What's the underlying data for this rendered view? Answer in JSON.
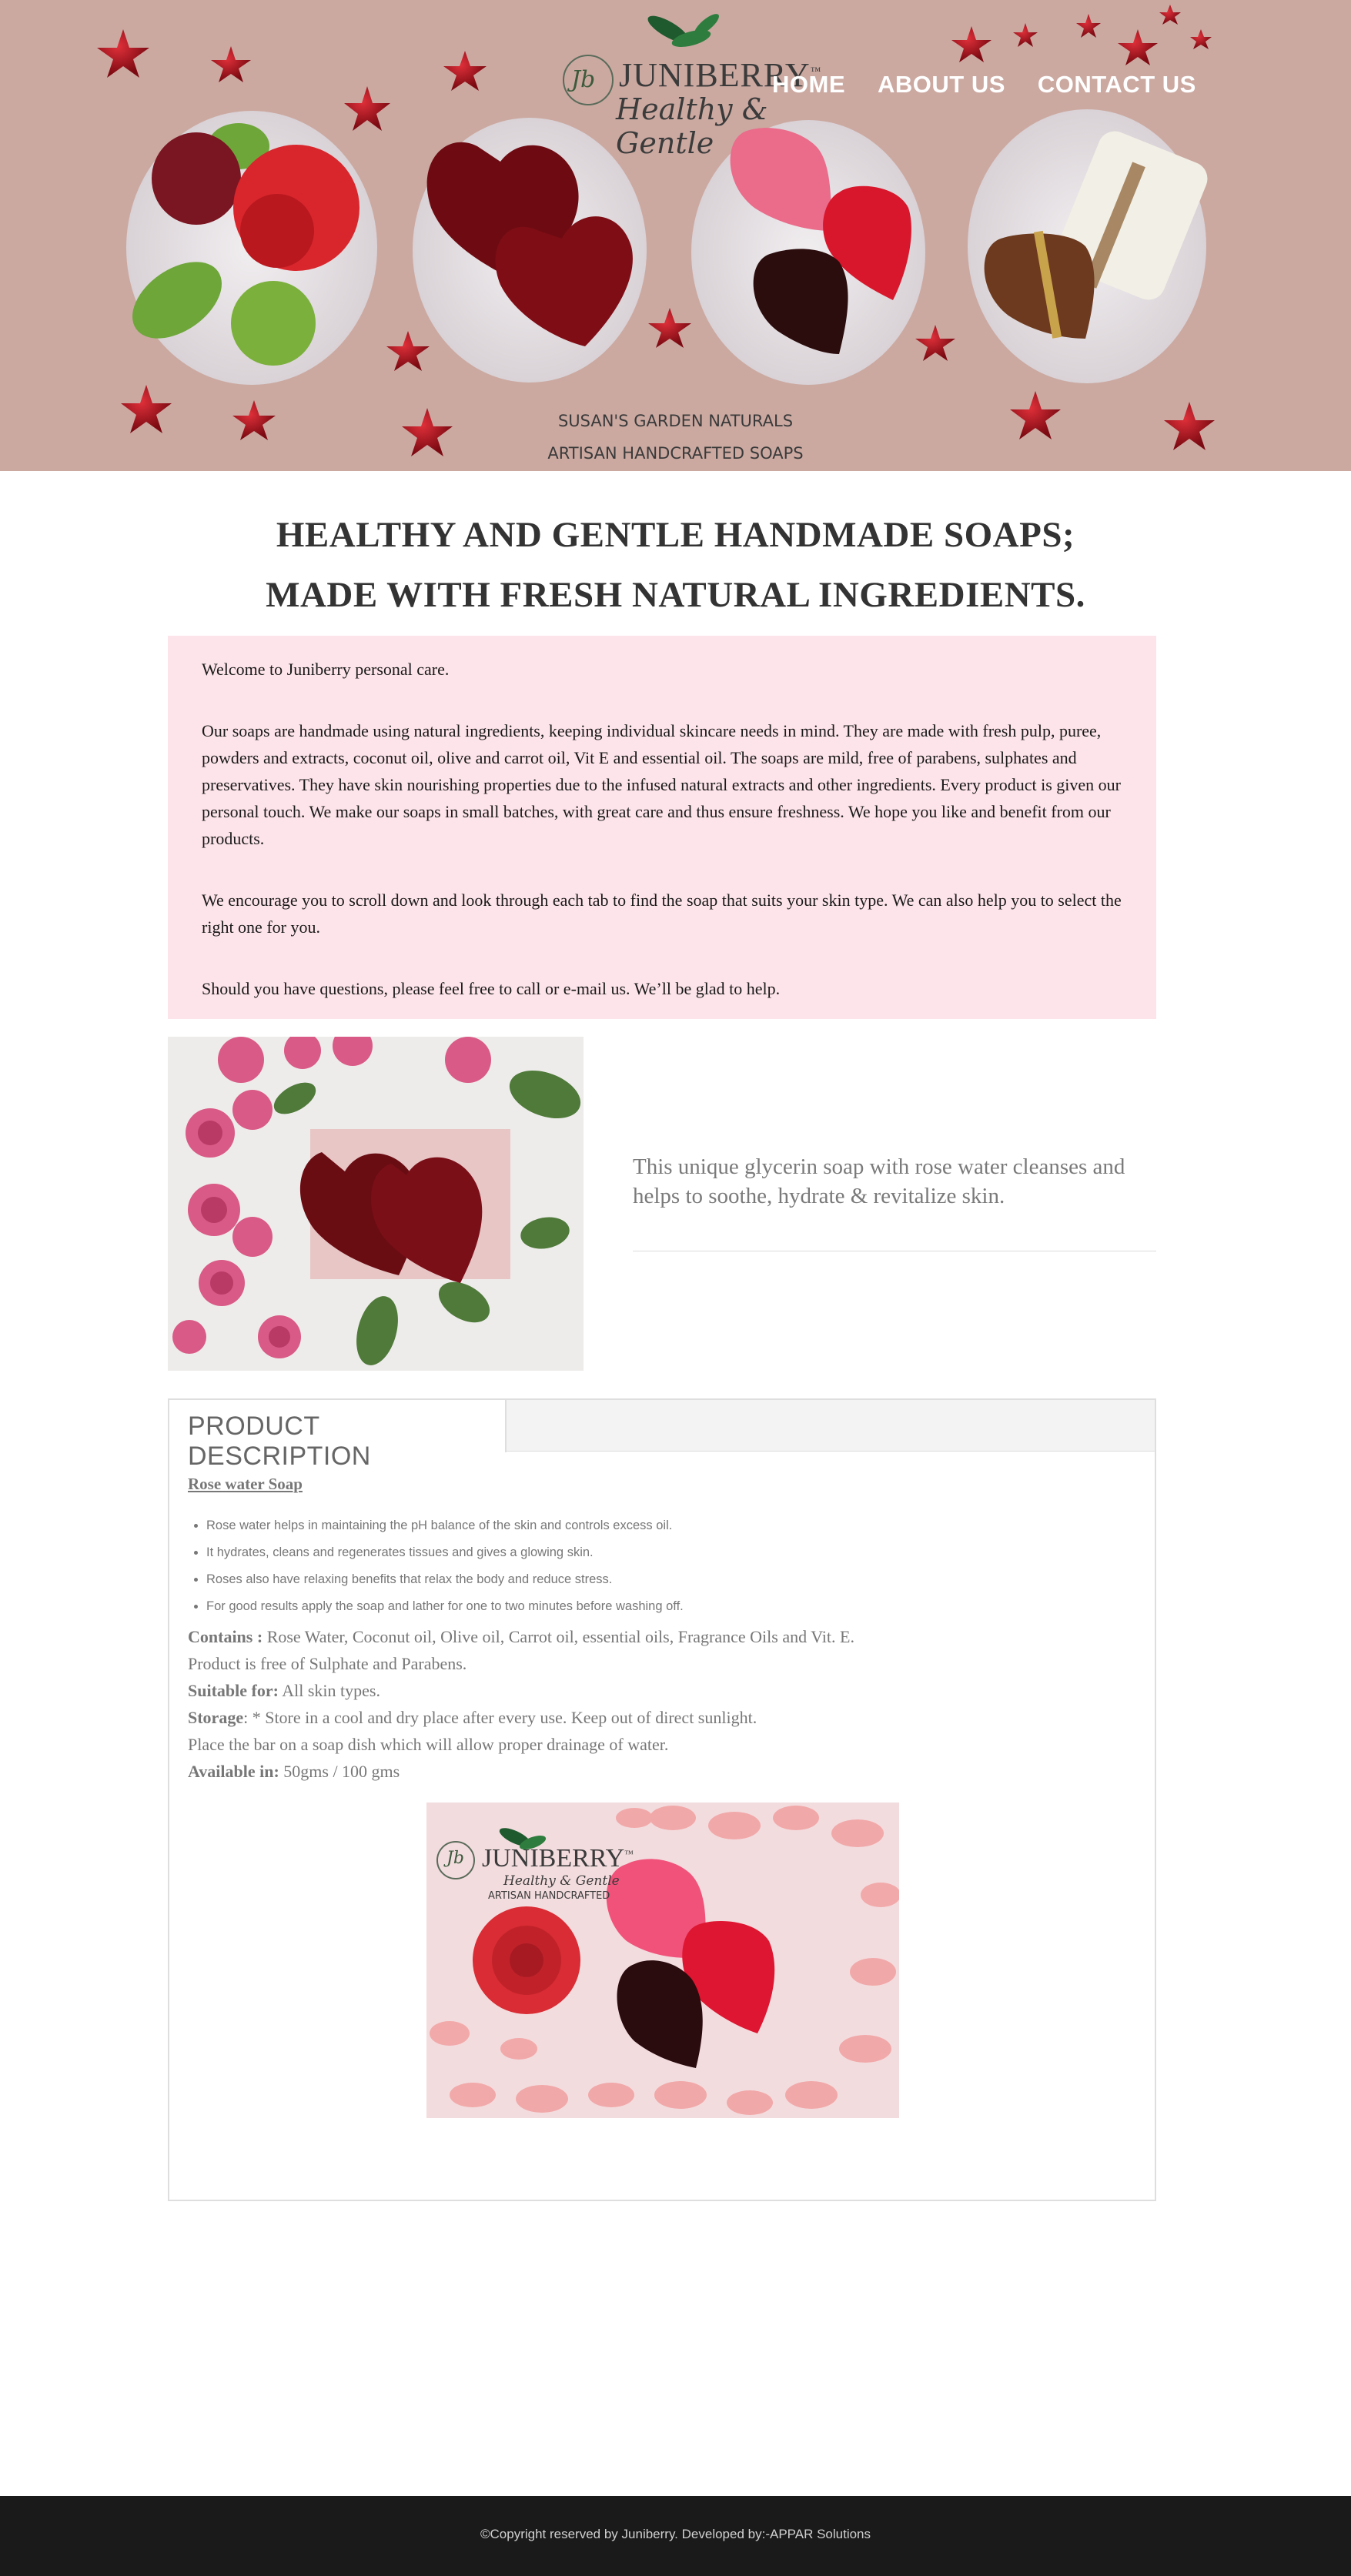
{
  "nav": {
    "items": [
      "HOME",
      "ABOUT US",
      "CONTACT US"
    ]
  },
  "hero": {
    "logo_brand": "JUNIBERRY",
    "logo_tm": "™",
    "logo_monogram": "Jb",
    "logo_tagline": "Healthy & Gentle",
    "caption_line1": "SUSAN'S GARDEN NATURALS",
    "caption_line2": "ARTISAN HANDCRAFTED SOAPS"
  },
  "heading": {
    "line1": "HEALTHY AND GENTLE HANDMADE SOAPS;",
    "line2": "MADE WITH FRESH NATURAL INGREDIENTS."
  },
  "intro": {
    "paragraphs": [
      "Welcome to Juniberry personal care.",
      "Our soaps are handmade using natural ingredients, keeping individual skincare needs in mind. They are made with fresh pulp, puree, powders and extracts, coconut oil, olive and carrot oil, Vit E and essential oil. The soaps are mild, free of parabens, sulphates and preservatives. They have skin nourishing properties due to the infused natural extracts and other ingredients. Every product is given our personal touch. We make our soaps in small batches, with great care and thus ensure freshness. We hope you like and benefit from our products.",
      "We encourage you to scroll down and look through each tab to find the soap that suits your skin type. We can also help you to select the right one for you.",
      "Should you have questions, please feel free to call or e-mail us. We’ll be glad to help."
    ]
  },
  "feature": {
    "text": "This unique glycerin soap with rose water cleanses and helps to soothe, hydrate & revitalize skin."
  },
  "tabs": {
    "active_label": "PRODUCT DESCRIPTION"
  },
  "product": {
    "name": "Rose water Soap",
    "bullets": [
      "Rose water helps in maintaining the pH balance of the skin and controls excess oil.",
      "It hydrates, cleans and regenerates tissues and gives a glowing skin.",
      "Roses also have relaxing benefits that relax the body and reduce stress.",
      "For good results apply the soap and lather for one to two minutes before washing off."
    ],
    "contains_label": "Contains :",
    "contains_value": " Rose Water, Coconut oil, Olive oil, Carrot oil, essential oils, Fragrance Oils and Vit. E.",
    "free_of": "Product is free of Sulphate and Parabens.",
    "suitable_label": "Suitable for:",
    "suitable_value": " All skin types.",
    "storage_label": "Storage",
    "storage_value": ":  * Store in a cool and dry place after every use. Keep out of direct sunlight.",
    "storage_note": "Place the bar on a soap dish which will allow proper drainage of water.",
    "available_label": "Available in:",
    "available_value": " 50gms / 100 gms",
    "image_brand": "JUNIBERRY",
    "image_tm": "™",
    "image_monogram": "Jb",
    "image_tagline": "Healthy & Gentle",
    "image_caption": "ARTISAN HANDCRAFTED"
  },
  "footer": {
    "text": "©Copyright reserved by Juniberry. Developed by:-APPAR Solutions"
  },
  "colors": {
    "hero_bg": "#cba9a1",
    "intro_bg": "#fde4ea",
    "footer_bg": "#1a1a1a",
    "star": "#a3121c"
  }
}
